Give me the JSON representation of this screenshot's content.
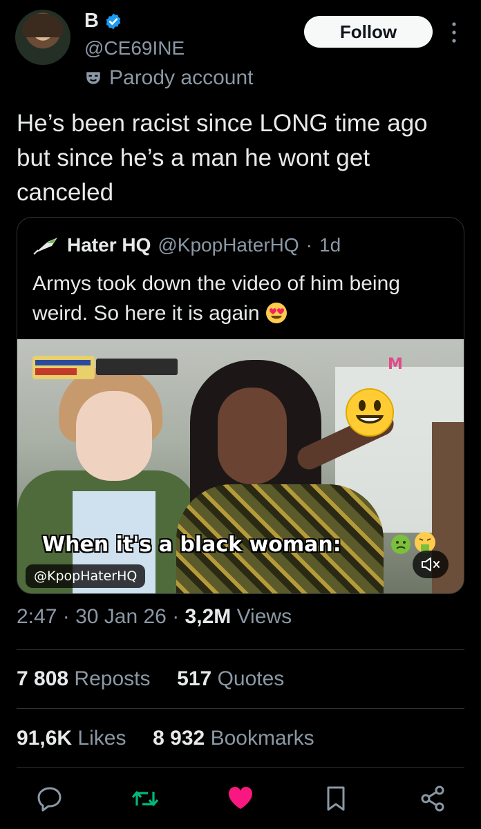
{
  "author": {
    "display_name": "B",
    "handle": "@CE69INE",
    "parody_label": "Parody account",
    "follow_label": "Follow"
  },
  "tweet": {
    "text": "He’s been racist since LONG time ago but since he’s a man he wont get canceled",
    "time": "2:47",
    "sep1": "·",
    "date": "30 Jan 26",
    "sep2": "·",
    "views_count": "3,2M",
    "views_label": "Views"
  },
  "quoted": {
    "name": "Hater HQ",
    "handle": "@KpopHaterHQ",
    "sep": "·",
    "time": "1d",
    "text": "Armys took down the video of him being weird. So here it is again",
    "video": {
      "caption": "When it's a black woman:",
      "watermark": "@KpopHaterHQ",
      "channel_logo": "M"
    }
  },
  "stats": {
    "reposts_count": "7 808",
    "reposts_label": "Reposts",
    "quotes_count": "517",
    "quotes_label": "Quotes",
    "likes_count": "91,6K",
    "likes_label": "Likes",
    "bookmarks_count": "8 932",
    "bookmarks_label": "Bookmarks"
  },
  "colors": {
    "background": "#000000",
    "text": "#e7e9ea",
    "muted": "#8b98a5",
    "verified": "#1d9bf0",
    "repost_green": "#00ba7c",
    "like_pink": "#f91880"
  },
  "icons": [
    "verified-badge-icon",
    "parody-mask-icon",
    "more-icon",
    "reply-icon",
    "repost-icon",
    "like-icon",
    "bookmark-icon",
    "share-icon",
    "mute-icon"
  ]
}
